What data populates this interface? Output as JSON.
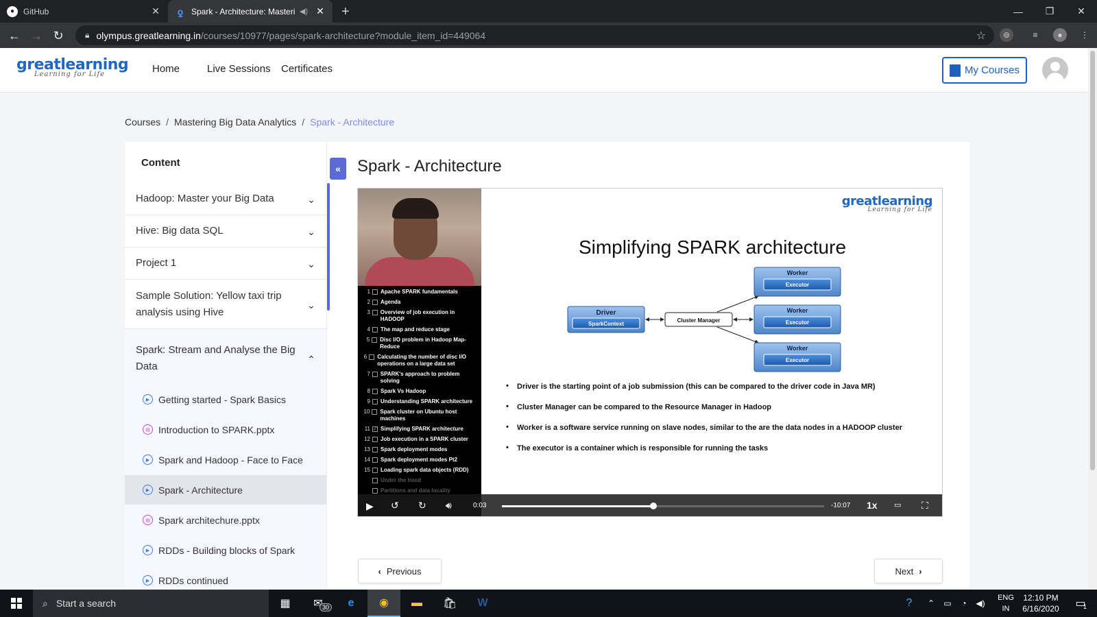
{
  "browser": {
    "tabs": [
      {
        "title": "GitHub",
        "icon": "github-icon"
      },
      {
        "title": "Spark - Architecture: Masteri",
        "icon": "greatlearning-favicon",
        "active": true
      }
    ],
    "url_host": "olympus.greatlearning.in",
    "url_path": "/courses/10977/pages/spark-architecture?module_item_id=449064"
  },
  "header": {
    "logo_main": "greatlearning",
    "logo_tagline": "Learning for Life",
    "nav": [
      "Home",
      "Live Sessions",
      "Certificates"
    ],
    "my_courses": "My Courses"
  },
  "breadcrumb": {
    "items": [
      "Courses",
      "Mastering Big Data Analytics",
      "Spark - Architecture"
    ],
    "separator": "/"
  },
  "sidebar": {
    "title": "Content",
    "modules": [
      {
        "title": "Hadoop: Master your Big Data",
        "expanded": false
      },
      {
        "title": "Hive: Big data SQL",
        "expanded": false
      },
      {
        "title": "Project 1",
        "expanded": false
      },
      {
        "title": "Sample Solution: Yellow taxi trip analysis using Hive",
        "expanded": false
      },
      {
        "title": "Spark: Stream and Analyse the Big Data",
        "expanded": true
      }
    ],
    "items": [
      {
        "label": "Getting started - Spark Basics",
        "type": "video"
      },
      {
        "label": "Introduction to SPARK.pptx",
        "type": "document"
      },
      {
        "label": "Spark and Hadoop - Face to Face",
        "type": "video"
      },
      {
        "label": "Spark - Architecture",
        "type": "video",
        "active": true
      },
      {
        "label": "Spark architechure.pptx",
        "type": "document"
      },
      {
        "label": "RDDs - Building blocks of Spark",
        "type": "video"
      },
      {
        "label": "RDDs continued",
        "type": "video"
      }
    ]
  },
  "main": {
    "title": "Spark - Architecture",
    "previous": "Previous",
    "next": "Next"
  },
  "slide": {
    "logo_main": "greatlearning",
    "logo_tagline": "Learning for Life",
    "title": "Simplifying SPARK architecture",
    "diagram": {
      "driver": "Driver",
      "spark_context": "SparkContext",
      "cluster_manager": "Cluster Manager",
      "worker": "Worker",
      "executor": "Executor"
    },
    "bullets": [
      "Driver is the starting point of a job submission (this can be compared to the driver code in Java MR)",
      "Cluster Manager can be compared to the Resource Manager in Hadoop",
      "Worker is a  software service running on slave nodes, similar to the  are the data nodes in a HADOOP cluster",
      "The executor is a container which is responsible for running the tasks"
    ],
    "toc": [
      {
        "n": "1",
        "label": "Apache SPARK fundamentals",
        "checked": false
      },
      {
        "n": "2",
        "label": "Agenda",
        "checked": false
      },
      {
        "n": "3",
        "label": "Overview of job execution in HADOOP",
        "checked": false
      },
      {
        "n": "4",
        "label": "The map and reduce stage",
        "checked": false
      },
      {
        "n": "5",
        "label": "Disc I/O problem in Hadoop Map-Reduce",
        "checked": false
      },
      {
        "n": "6",
        "label": "Calculating the number of disc I/O operations on a large data set",
        "checked": false
      },
      {
        "n": "7",
        "label": "SPARK's approach to problem solving",
        "checked": false
      },
      {
        "n": "8",
        "label": "Spark Vs Hadoop",
        "checked": false
      },
      {
        "n": "9",
        "label": "Understanding SPARK architecture",
        "checked": false
      },
      {
        "n": "10",
        "label": "Spark cluster on Ubuntu host machines",
        "checked": false
      },
      {
        "n": "11",
        "label": "Simplifying SPARK architecture",
        "checked": true
      },
      {
        "n": "12",
        "label": "Job execution in a SPARK cluster",
        "checked": false
      },
      {
        "n": "13",
        "label": "Spark deployment modes",
        "checked": false
      },
      {
        "n": "14",
        "label": "Spark deployment modes Pt2",
        "checked": false
      },
      {
        "n": "15",
        "label": "Loading spark data objects (RDD)",
        "checked": false
      },
      {
        "n": "",
        "label": "Under the hood",
        "checked": false
      },
      {
        "n": "",
        "label": "Partitions and data locality",
        "checked": false
      }
    ]
  },
  "player": {
    "current_time": "0:03",
    "remaining_time": "-10:07",
    "speed": "1x",
    "progress": 0.47
  },
  "taskbar": {
    "search_placeholder": "Start a search",
    "mail_badge": "30",
    "lang_top": "ENG",
    "lang_bottom": "IN",
    "time": "12:10 PM",
    "date": "6/16/2020",
    "notifications": "1"
  }
}
